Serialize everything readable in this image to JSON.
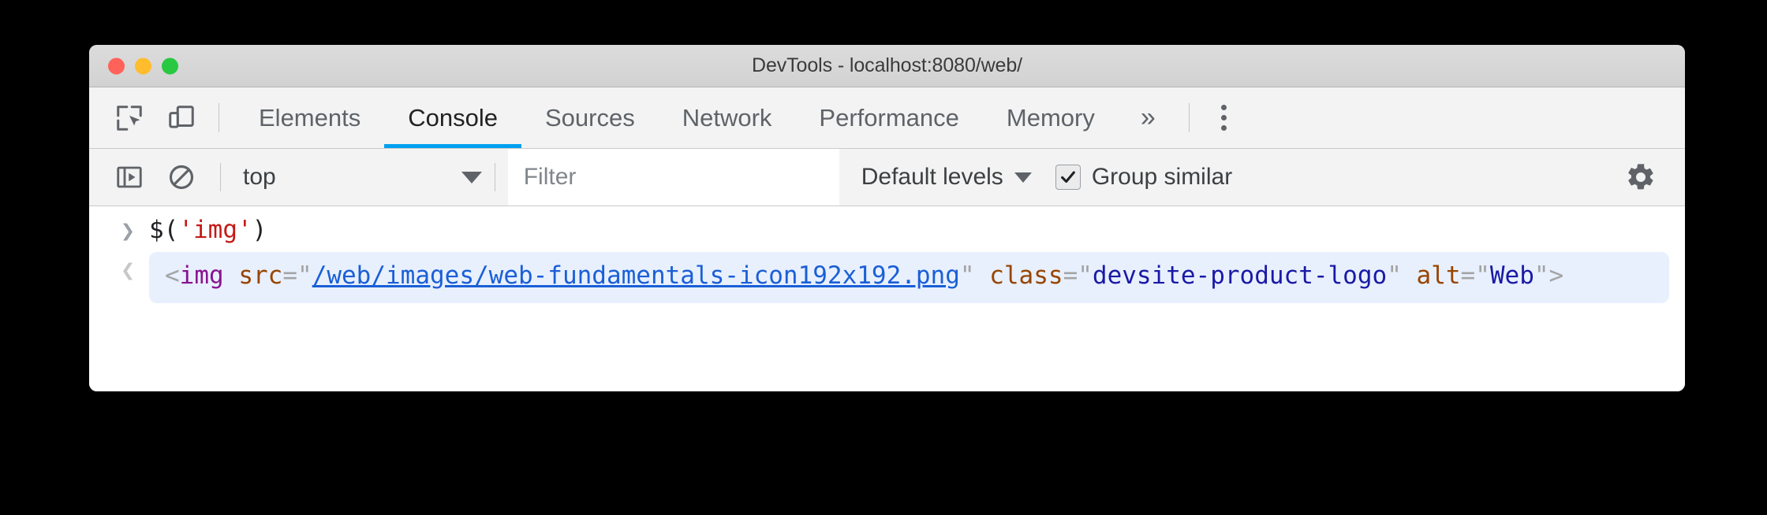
{
  "window": {
    "title": "DevTools - localhost:8080/web/",
    "traffic_lights": [
      "close",
      "minimize",
      "maximize"
    ]
  },
  "tabbar": {
    "inspect_icon": "inspect-element-icon",
    "device_icon": "device-toolbar-icon",
    "tabs": [
      {
        "label": "Elements",
        "active": false
      },
      {
        "label": "Console",
        "active": true
      },
      {
        "label": "Sources",
        "active": false
      },
      {
        "label": "Network",
        "active": false
      },
      {
        "label": "Performance",
        "active": false
      },
      {
        "label": "Memory",
        "active": false
      }
    ],
    "more_tabs_label": "»",
    "menu_icon": "vertical-dots-icon",
    "active_tab_underline_color": "#00a0f0"
  },
  "console_toolbar": {
    "sidebar_toggle_icon": "console-sidebar-icon",
    "clear_icon": "clear-console-icon",
    "context": {
      "value": "top",
      "caret": "▼"
    },
    "filter": {
      "value": "",
      "placeholder": "Filter"
    },
    "levels": {
      "label": "Default levels",
      "caret": "▼"
    },
    "group_similar": {
      "label": "Group similar",
      "checked": true,
      "check_glyph": "✔"
    },
    "settings_icon": "gear-icon"
  },
  "console": {
    "input": {
      "prompt": "❯",
      "tokens": [
        {
          "text": "$(",
          "cls": "t-plain"
        },
        {
          "text": "'img'",
          "cls": "t-string"
        },
        {
          "text": ")",
          "cls": "t-plain"
        }
      ],
      "raw": "$('img')"
    },
    "result": {
      "arrow": "❮",
      "raw": "<img src=\"/web/images/web-fundamentals-icon192x192.png\" class=\"devsite-product-logo\" alt=\"Web\">",
      "tokens": [
        {
          "text": "<",
          "cls": "t-punct"
        },
        {
          "text": "img",
          "cls": "t-tag"
        },
        {
          "text": " ",
          "cls": "t-plain"
        },
        {
          "text": "src",
          "cls": "t-attr"
        },
        {
          "text": "=",
          "cls": "t-eq"
        },
        {
          "text": "\"",
          "cls": "t-quote"
        },
        {
          "text": "/web/images/web-fundamentals-icon192x192.png",
          "cls": "t-link"
        },
        {
          "text": "\"",
          "cls": "t-quote"
        },
        {
          "text": " ",
          "cls": "t-plain"
        },
        {
          "text": "class",
          "cls": "t-attr"
        },
        {
          "text": "=",
          "cls": "t-eq"
        },
        {
          "text": "\"",
          "cls": "t-quote"
        },
        {
          "text": "devsite-product-logo",
          "cls": "t-value"
        },
        {
          "text": "\"",
          "cls": "t-quote"
        },
        {
          "text": " ",
          "cls": "t-plain"
        },
        {
          "text": "alt",
          "cls": "t-attr"
        },
        {
          "text": "=",
          "cls": "t-eq"
        },
        {
          "text": "\"",
          "cls": "t-quote"
        },
        {
          "text": "Web",
          "cls": "t-value"
        },
        {
          "text": "\"",
          "cls": "t-quote"
        },
        {
          "text": ">",
          "cls": "t-punct"
        }
      ],
      "highlight_background": "#e8f0fe"
    }
  }
}
